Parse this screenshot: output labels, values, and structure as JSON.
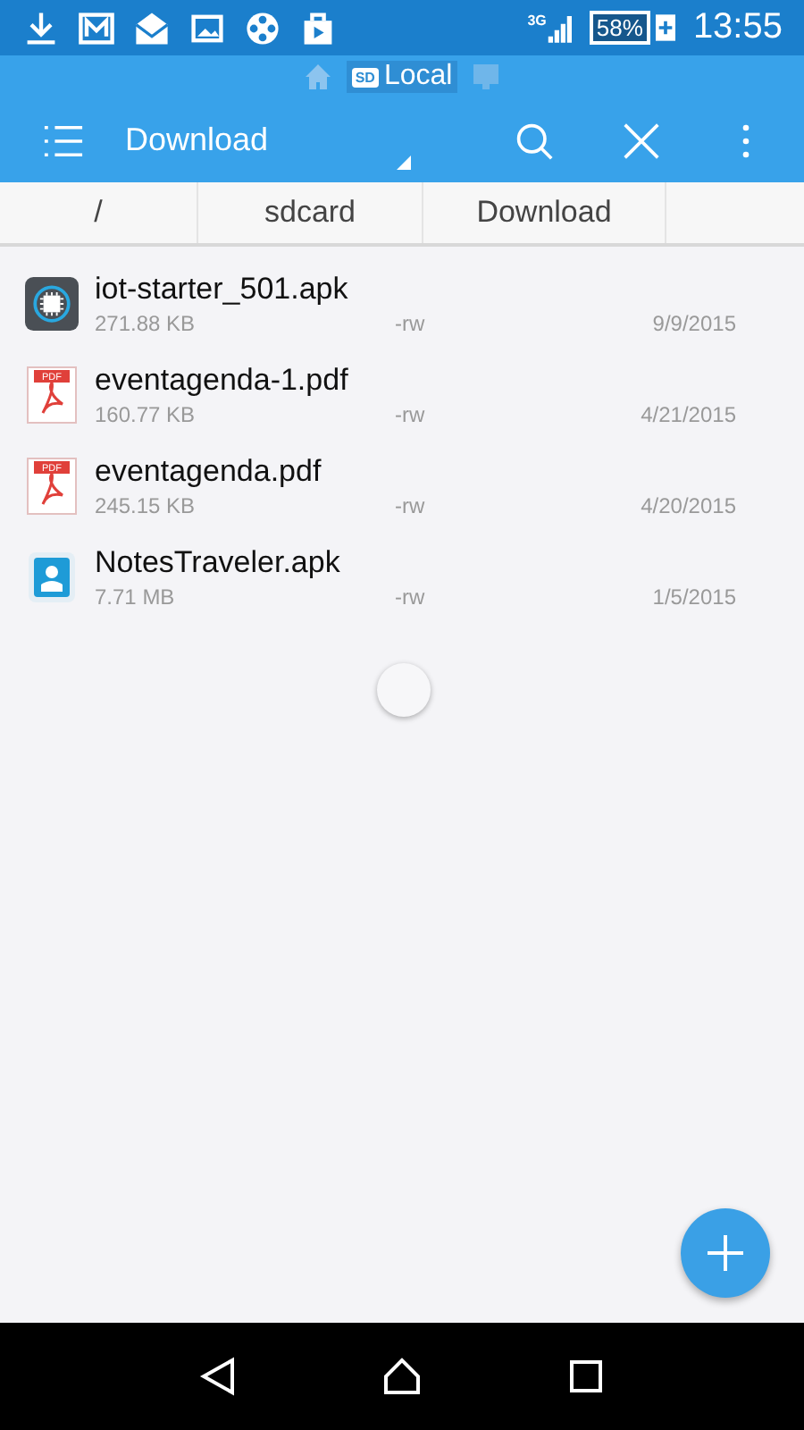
{
  "status_bar": {
    "network": "3G",
    "battery": "58%",
    "time": "13:55"
  },
  "location_tabs": {
    "storage_badge": "SD",
    "label": "Local"
  },
  "toolbar": {
    "title": "Download"
  },
  "breadcrumb": [
    "/",
    "sdcard",
    "Download"
  ],
  "files": [
    {
      "kind": "chip",
      "name": "iot-starter_501.apk",
      "size": "271.88 KB",
      "permissions": "-rw",
      "date": "9/9/2015"
    },
    {
      "kind": "pdf",
      "icon_label": "PDF",
      "name": "eventagenda-1.pdf",
      "size": "160.77 KB",
      "permissions": "-rw",
      "date": "4/21/2015"
    },
    {
      "kind": "pdf",
      "icon_label": "PDF",
      "name": "eventagenda.pdf",
      "size": "245.15 KB",
      "permissions": "-rw",
      "date": "4/20/2015"
    },
    {
      "kind": "contact",
      "name": "NotesTraveler.apk",
      "size": "7.71 MB",
      "permissions": "-rw",
      "date": "1/5/2015"
    }
  ]
}
